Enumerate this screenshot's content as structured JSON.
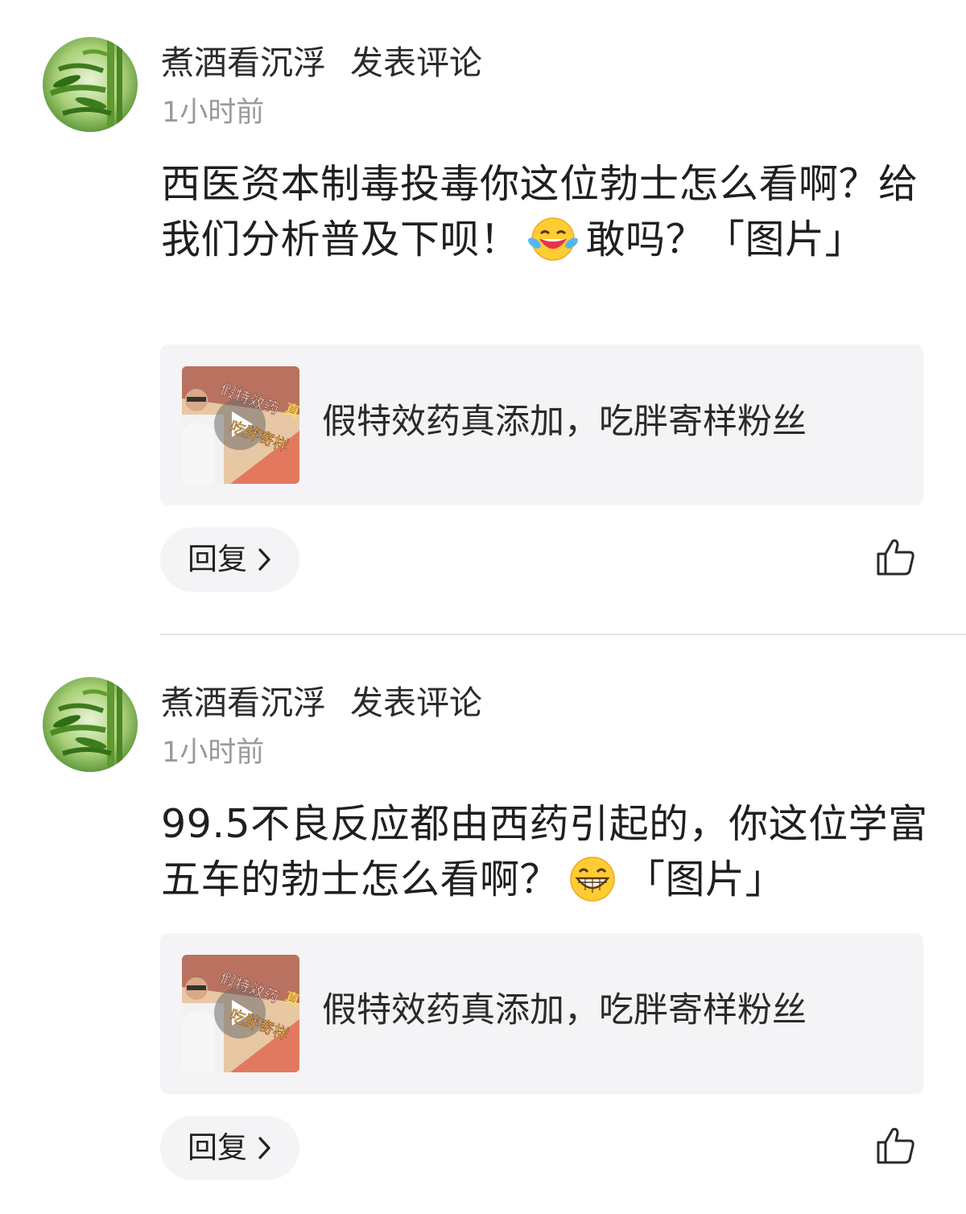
{
  "comments": [
    {
      "author": "煮酒看沉浮",
      "action": "发表评论",
      "time": "1小时前",
      "text_parts": [
        "西医资本制毒投毒你这位勃士怎么看啊？给我们分析普及下呗！",
        "敢吗？「图片」"
      ],
      "emoji": "laughing-tears-emoji",
      "card_title": "假特效药真添加，吃胖寄样粉丝",
      "thumb_overlay_text": [
        "假特效药",
        "真",
        "吃胖寄样"
      ],
      "reply_label": "回复",
      "like_icon": "thumbs-up-icon"
    },
    {
      "author": "煮酒看沉浮",
      "action": "发表评论",
      "time": "1小时前",
      "text_parts": [
        "99.5不良反应都由西药引起的，你这位学富五车的勃士怎么看啊？",
        "「图片」"
      ],
      "emoji": "grinning-emoji",
      "card_title": "假特效药真添加，吃胖寄样粉丝",
      "thumb_overlay_text": [
        "假特效药",
        "真",
        "吃胖寄样"
      ],
      "reply_label": "回复",
      "like_icon": "thumbs-up-icon"
    }
  ],
  "colors": {
    "background": "#ffffff",
    "card_background": "#f4f4f6",
    "secondary_text": "#9a9a9a",
    "primary_text": "#1f1f1f"
  }
}
